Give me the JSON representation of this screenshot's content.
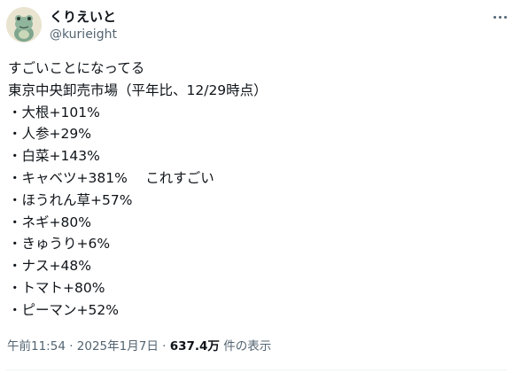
{
  "author": {
    "display_name": "くりえいと",
    "handle": "@kurieight",
    "avatar_icon": "frog-avatar-icon"
  },
  "menu": {
    "icon": "more-options-icon"
  },
  "tweet": {
    "lines": [
      "すごいことになってる",
      "東京中央卸売市場（平年比、12/29時点）",
      "・大根+101%",
      "・人参+29%",
      "・白菜+143%",
      "・キャベツ+381%　 これすごい",
      "・ほうれん草+57%",
      "・ネギ+80%",
      "・きゅうり+6%",
      "・ナス+48%",
      "・トマト+80%",
      "・ピーマン+52%"
    ]
  },
  "meta": {
    "time": "午前11:54",
    "separator": " · ",
    "date": "2025年1月7日",
    "separator2": " · ",
    "views_count": "637.4万",
    "views_label": " 件の表示"
  },
  "colors": {
    "text": "#0f1419",
    "secondary": "#536471",
    "divider": "#eff3f4"
  }
}
